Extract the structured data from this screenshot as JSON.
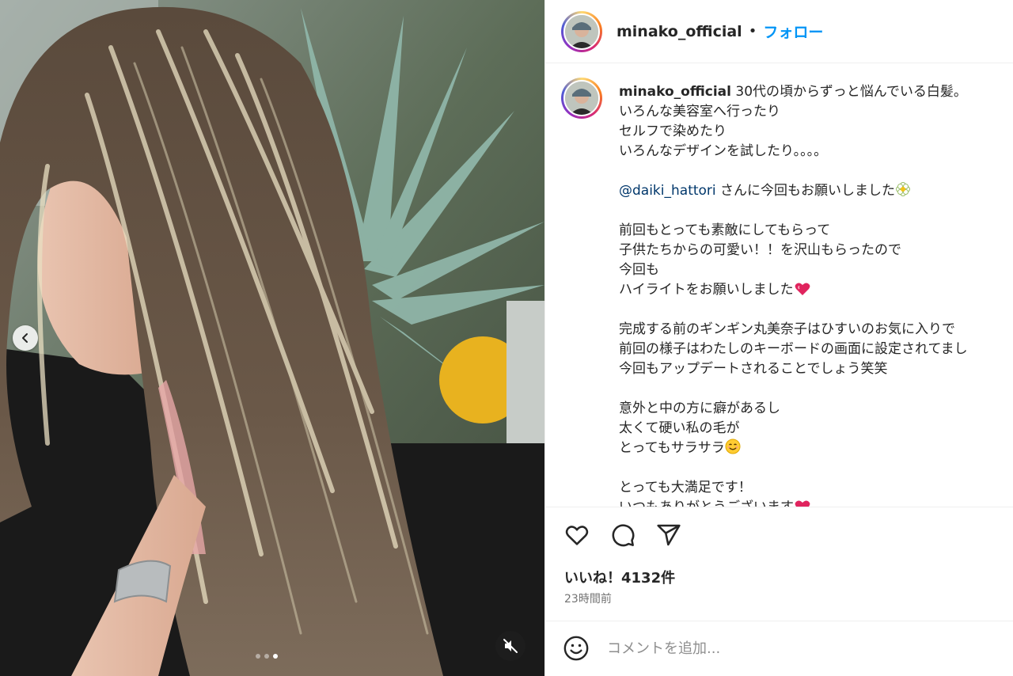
{
  "post": {
    "username": "minako_official",
    "separator": "•",
    "follow_label": "フォロー"
  },
  "caption": {
    "username": "minako_official",
    "line1": " 30代の頃からずっと悩んでいる白髪。",
    "line2": "いろんな美容室へ行ったり",
    "line3": "セルフで染めたり",
    "line4": "いろんなデザインを試したり。。。。",
    "mention": "@daiki_hattori",
    "line5": " さんに今回もお願いしました",
    "line6": "前回もとっても素敵にしてもらって",
    "line7": "子供たちからの可愛い！！を沢山もらったので",
    "line8": "今回も",
    "line9": "ハイライトをお願いしました",
    "line10": "完成する前のギンギン丸美奈子はひすいのお気に入りで",
    "line11": "前回の様子はわたしのキーボードの画面に設定されてまし",
    "line12": "今回もアップデートされることでしょう笑笑",
    "line13": "意外と中の方に癖があるし",
    "line14": "太くて硬い私の毛が",
    "line15": "とってもサラサラ",
    "line16": "とっても大満足です！",
    "line17": "いつもありがとうございます"
  },
  "actions": {
    "like_icon": "heart-icon",
    "comment_icon": "comment-icon",
    "share_icon": "send-icon"
  },
  "likes_text": "いいね！4132件",
  "timestamp": "23時間前",
  "comment": {
    "placeholder": "コメントを追加..."
  },
  "carousel": {
    "slide_count": 3,
    "active_index": 2
  },
  "colors": {
    "follow": "#0095f6",
    "mention": "#00376b",
    "text": "#262626",
    "muted": "#737373"
  }
}
